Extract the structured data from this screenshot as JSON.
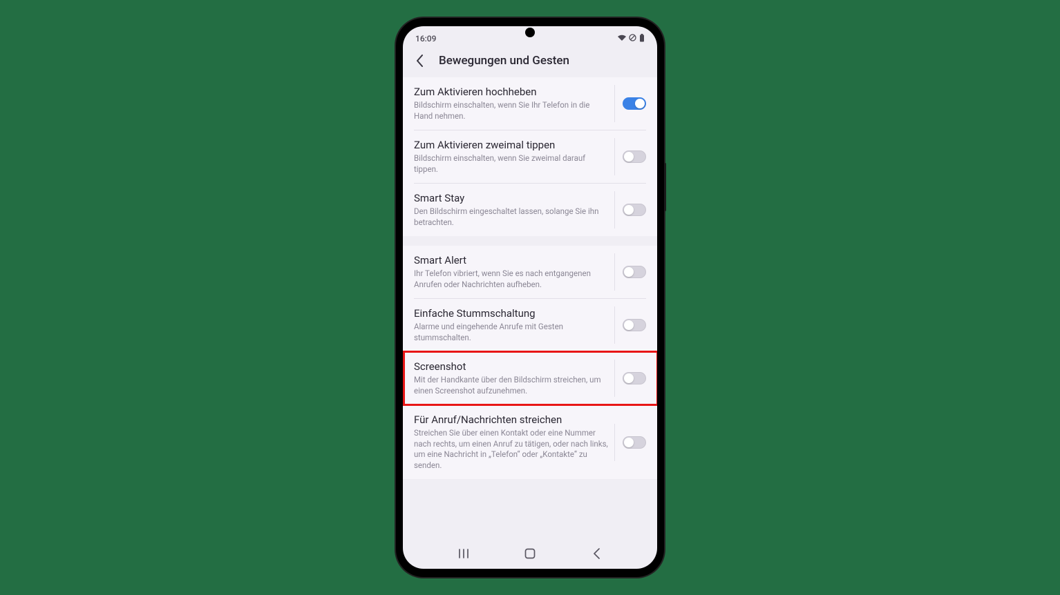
{
  "statusbar": {
    "time": "16:09"
  },
  "header": {
    "title": "Bewegungen und Gesten"
  },
  "settings": [
    {
      "title": "Zum Aktivieren hochheben",
      "sub": "Bildschirm einschalten, wenn Sie Ihr Telefon in die Hand nehmen.",
      "on": true
    },
    {
      "title": "Zum Aktivieren zweimal tippen",
      "sub": "Bildschirm einschalten, wenn Sie zweimal darauf tippen.",
      "on": false
    },
    {
      "title": "Smart Stay",
      "sub": "Den Bildschirm eingeschaltet lassen, solange Sie ihn betrachten.",
      "on": false
    },
    {
      "title": "Smart Alert",
      "sub": "Ihr Telefon vibriert, wenn Sie es nach entgangenen Anrufen oder Nachrichten aufheben.",
      "on": false
    },
    {
      "title": "Einfache Stummschaltung",
      "sub": "Alarme und eingehende Anrufe mit Gesten stummschalten.",
      "on": false
    },
    {
      "title": "Screenshot",
      "sub": "Mit der Handkante über den Bildschirm streichen, um einen Screenshot aufzunehmen.",
      "on": false,
      "highlighted": true
    },
    {
      "title": "Für Anruf/Nachrichten streichen",
      "sub": "Streichen Sie über einen Kontakt oder eine Nummer nach rechts, um einen Anruf zu tätigen, oder nach links, um eine Nachricht in „Telefon“ oder „Kontakte“ zu senden.",
      "on": false
    }
  ],
  "groups": [
    [
      0,
      1,
      2
    ],
    [
      3,
      4,
      5,
      6
    ]
  ]
}
